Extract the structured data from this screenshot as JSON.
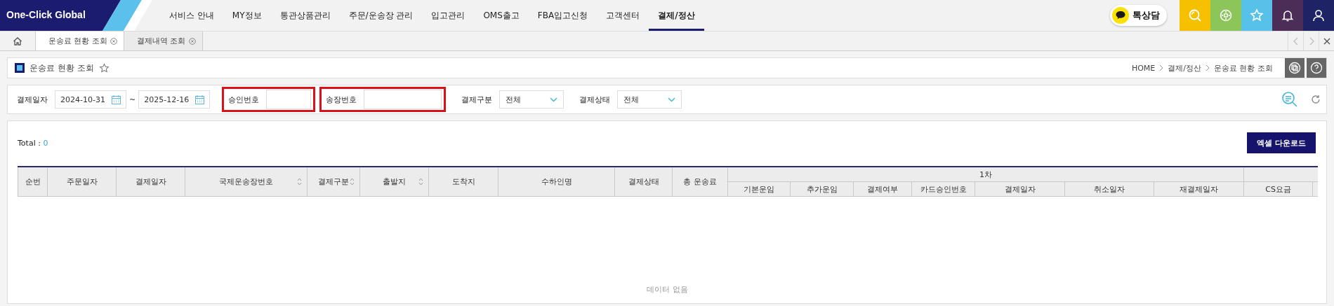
{
  "logo": "One-Click Global",
  "nav": [
    {
      "label": "서비스 안내",
      "selected": false
    },
    {
      "label": "MY정보",
      "selected": false
    },
    {
      "label": "통관상품관리",
      "selected": false
    },
    {
      "label": "주문/운송장 관리",
      "selected": false
    },
    {
      "label": "입고관리",
      "selected": false
    },
    {
      "label": "OMS출고",
      "selected": false
    },
    {
      "label": "FBA입고신청",
      "selected": false
    },
    {
      "label": "고객센터",
      "selected": false
    },
    {
      "label": "결제/정산",
      "selected": true
    }
  ],
  "kakao_button": "톡상담",
  "tabs": [
    {
      "label": "운송료 현황 조회",
      "selected": true
    },
    {
      "label": "결제내역 조회",
      "selected": false
    }
  ],
  "page_title": "운송료 현황 조회",
  "breadcrumb": [
    "HOME",
    "결제/정산",
    "운송료 현황 조회"
  ],
  "filters": {
    "date_label": "결제일자",
    "date_from": "2024-10-31",
    "range_separator": "~",
    "date_to": "2025-12-16",
    "text_fields": [
      {
        "label": "승인번호",
        "highlighted": true
      },
      {
        "label": "송장번호",
        "highlighted": true
      }
    ],
    "selects": [
      {
        "label": "결제구분",
        "value": "전체"
      },
      {
        "label": "결제상태",
        "value": "전체"
      }
    ]
  },
  "total_label": "Total :",
  "total_count": "0",
  "excel_button": "엑셀 다운로드",
  "table": {
    "columns": [
      {
        "label": "순번",
        "sortable": false
      },
      {
        "label": "주문일자",
        "sortable": false
      },
      {
        "label": "결제일자",
        "sortable": false
      },
      {
        "label": "국제운송장번호",
        "sortable": true
      },
      {
        "label": "결제구분",
        "sortable": true
      },
      {
        "label": "출발지",
        "sortable": true
      },
      {
        "label": "도착지",
        "sortable": false
      },
      {
        "label": "수하인명",
        "sortable": false
      },
      {
        "label": "결제상태",
        "sortable": false
      },
      {
        "label": "총 운송료",
        "sortable": false
      }
    ],
    "group": {
      "label": "1차",
      "columns": [
        "기본운임",
        "추가운임",
        "결제여부",
        "카드승인번호",
        "결제일자",
        "취소일자",
        "재결제일자"
      ]
    },
    "extra_columns": [
      "CS요금"
    ],
    "empty_message": "데이터 없음"
  }
}
